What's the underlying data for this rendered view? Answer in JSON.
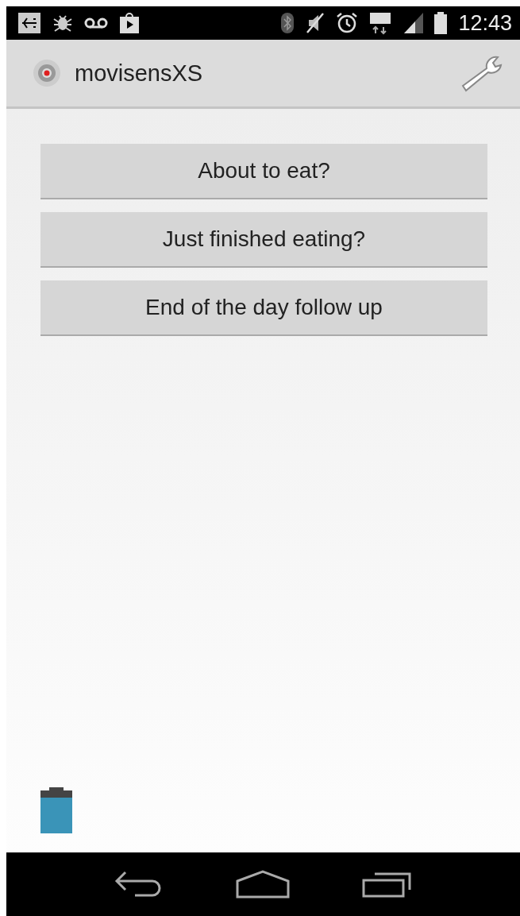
{
  "status_bar": {
    "time": "12:43"
  },
  "app_bar": {
    "title": "movisensXS"
  },
  "buttons": [
    "About to eat?",
    "Just finished eating?",
    "End of the day follow up"
  ]
}
